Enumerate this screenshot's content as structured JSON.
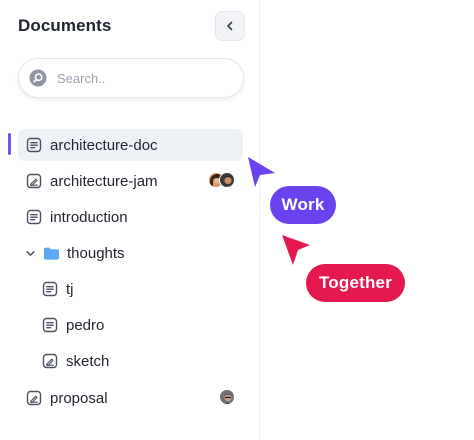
{
  "sidebar": {
    "title": "Documents",
    "search": {
      "placeholder": "Search..",
      "value": ""
    },
    "items": [
      {
        "label": "architecture-doc",
        "icon": "document-icon",
        "selected": true
      },
      {
        "label": "architecture-jam",
        "icon": "whiteboard-icon",
        "collaborators": 2
      },
      {
        "label": "introduction",
        "icon": "document-icon"
      },
      {
        "label": "thoughts",
        "icon": "folder-icon",
        "expanded": true
      },
      {
        "label": "tj",
        "icon": "document-icon"
      },
      {
        "label": "pedro",
        "icon": "document-icon"
      },
      {
        "label": "sketch",
        "icon": "whiteboard-icon"
      },
      {
        "label": "proposal",
        "icon": "whiteboard-icon",
        "collaborators": 1
      }
    ]
  },
  "cursors": [
    {
      "label": "Work",
      "color": "#6a43ee"
    },
    {
      "label": "Together",
      "color": "#e5194f"
    }
  ],
  "colors": {
    "selection_bar": "#6f58e8",
    "selection_bg": "#eef1f6",
    "folder": "#5aa9f2"
  }
}
